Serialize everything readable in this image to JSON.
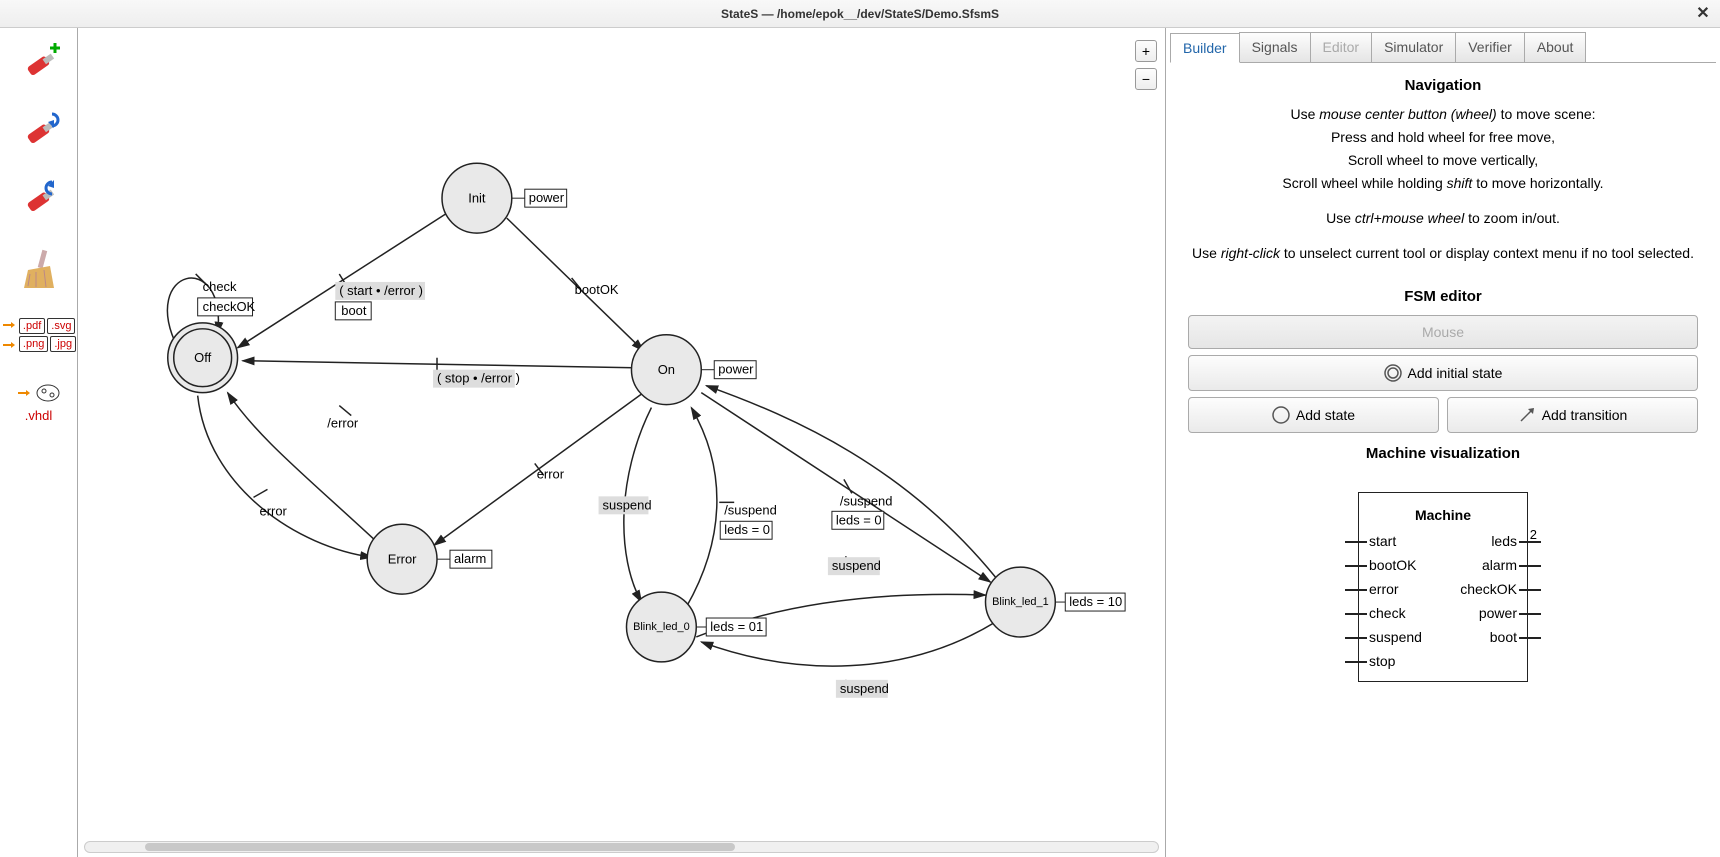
{
  "title": "StateS — /home/epok__/dev/StateS/Demo.SfsmS",
  "zoom": {
    "in": "+",
    "out": "−"
  },
  "toolbar_exts": {
    "pdf": ".pdf",
    "svg": ".svg",
    "png": ".png",
    "jpg": ".jpg",
    "vhdl": ".vhdl"
  },
  "states": {
    "init": {
      "label": "Init",
      "output": "power"
    },
    "off": {
      "label": "Off"
    },
    "on": {
      "label": "On",
      "output": "power"
    },
    "error": {
      "label": "Error",
      "output": "alarm"
    },
    "bl0": {
      "label": "Blink_led_0",
      "output": "leds = 01"
    },
    "bl1": {
      "label": "Blink_led_1",
      "output": "leds = 10"
    }
  },
  "transitions": {
    "off_self": {
      "cond": "check",
      "act": "checkOK"
    },
    "init_off": {
      "cond": "( start • /error )",
      "act": "boot"
    },
    "init_on": {
      "cond": "bootOK"
    },
    "on_off": {
      "cond": "( stop • /error )"
    },
    "off_error": {
      "cond": "error"
    },
    "on_error": {
      "cond": "/error"
    },
    "on_error2": {
      "cond": "error"
    },
    "on_bl0": {
      "cond": "suspend"
    },
    "bl0_on": {
      "cond": "/suspend",
      "act": "leds = 0"
    },
    "on_bl1": {
      "cond": "/suspend",
      "act": "leds = 0"
    },
    "bl1_on": {
      "cond": "suspend"
    },
    "bl0_bl1": {
      "cond": "suspend"
    },
    "bl1_bl0": {
      "cond": "suspend"
    }
  },
  "tabs": [
    "Builder",
    "Signals",
    "Editor",
    "Simulator",
    "Verifier",
    "About"
  ],
  "nav": {
    "heading": "Navigation",
    "l1a": "Use ",
    "l1b": "mouse center button (wheel)",
    "l1c": " to move scene:",
    "l2": "Press and hold wheel for free move,",
    "l3": "Scroll wheel to move vertically,",
    "l4a": "Scroll wheel while holding ",
    "l4b": "shift",
    "l4c": " to move horizontally.",
    "l5a": "Use ",
    "l5b": "ctrl+mouse wheel",
    "l5c": " to zoom in/out.",
    "l6a": "Use ",
    "l6b": "right-click",
    "l6c": " to unselect current tool or display context menu if no tool selected."
  },
  "fsm": {
    "heading": "FSM editor",
    "mouse": "Mouse",
    "add_initial": "Add initial state",
    "add_state": "Add state",
    "add_trans": "Add transition"
  },
  "mv": {
    "heading": "Machine visualization",
    "box_title": "Machine",
    "inputs": [
      "start",
      "bootOK",
      "error",
      "check",
      "suspend",
      "stop"
    ],
    "outputs": [
      "leds",
      "alarm",
      "checkOK",
      "power",
      "boot"
    ],
    "leds_width": "2"
  }
}
